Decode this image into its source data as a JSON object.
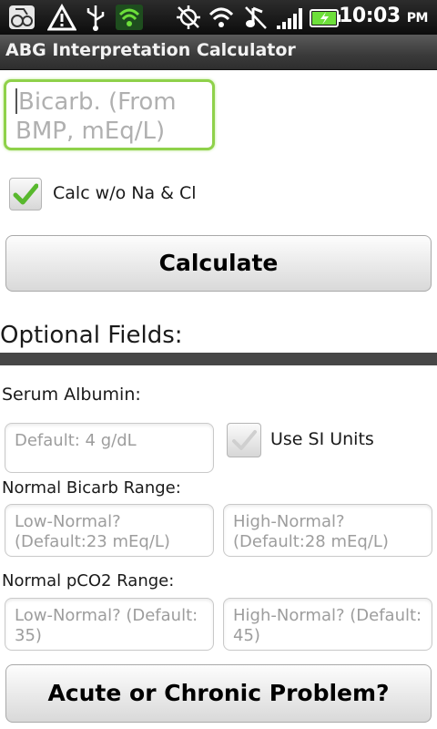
{
  "status_bar": {
    "icons": [
      "app-icon",
      "alert-icon",
      "usb-icon",
      "shield-icon",
      "gps-icon",
      "wifi-icon",
      "mute-icon",
      "signal-icon",
      "battery-icon"
    ],
    "time": "10:03",
    "ampm": "PM"
  },
  "app": {
    "title": "ABG Interpretation Calculator"
  },
  "bicarb": {
    "placeholder": "Bicarb. (From BMP, mEq/L)"
  },
  "calc_option": {
    "label": "Calc w/o Na & Cl",
    "checked": true
  },
  "calculate_button": "Calculate",
  "optional": {
    "title": "Optional Fields:",
    "serum_albumin": {
      "label": "Serum Albumin:",
      "placeholder": "Default: 4 g/dL",
      "si_units_label": "Use SI Units",
      "si_units_checked": false
    },
    "bicarb_range": {
      "label": "Normal Bicarb Range:",
      "low_placeholder": "Low-Normal? (Default:23 mEq/L)",
      "high_placeholder": "High-Normal? (Default:28 mEq/L)"
    },
    "pco2_range": {
      "label": "Normal pCO2 Range:",
      "low_placeholder": "Low-Normal? (Default: 35)",
      "high_placeholder": "High-Normal? (Default: 45)"
    }
  },
  "acute_button": "Acute or Chronic Problem?",
  "colors": {
    "focus_green": "#8fd14a",
    "check_green": "#58b82d",
    "divider": "#474747"
  }
}
